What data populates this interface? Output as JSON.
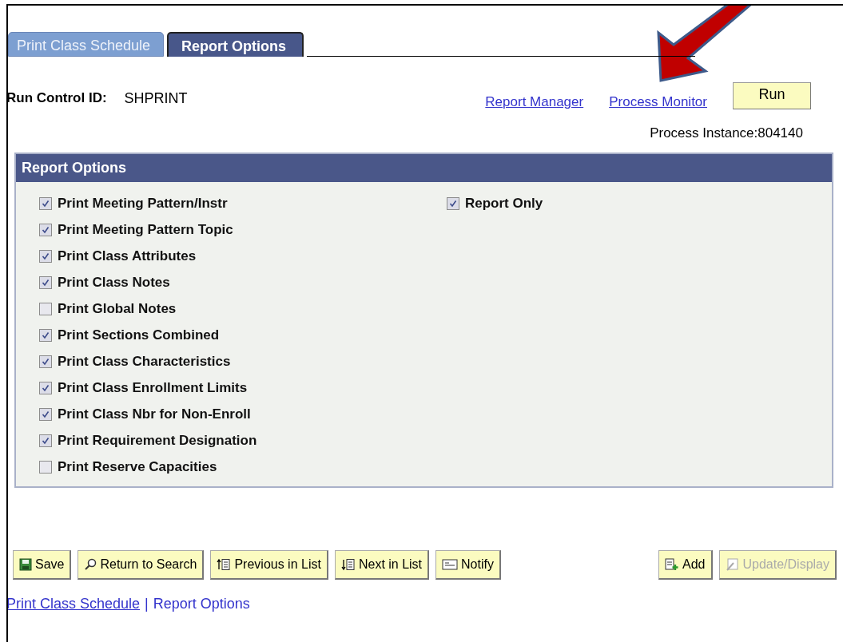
{
  "tabs": [
    {
      "label": "Print Class Schedule",
      "selected": false
    },
    {
      "label": "Report Options",
      "selected": true
    }
  ],
  "run_control": {
    "label": "Run Control ID:",
    "value": "SHPRINT"
  },
  "links": [
    "Report Manager",
    "Process Monitor"
  ],
  "run_button": "Run",
  "process_instance": "Process Instance:804140",
  "report_options": {
    "title": "Report Options",
    "left": [
      {
        "label": "Print Meeting Pattern/Instr",
        "checked": true
      },
      {
        "label": "Print Meeting Pattern Topic",
        "checked": true
      },
      {
        "label": "Print Class Attributes",
        "checked": true
      },
      {
        "label": "Print Class Notes",
        "checked": true
      },
      {
        "label": "Print Global Notes",
        "checked": false
      },
      {
        "label": "Print Sections Combined",
        "checked": true
      },
      {
        "label": "Print Class Characteristics",
        "checked": true
      },
      {
        "label": "Print Class Enrollment Limits",
        "checked": true
      },
      {
        "label": "Print Class Nbr for Non-Enroll",
        "checked": true
      },
      {
        "label": "Print Requirement Designation",
        "checked": true
      },
      {
        "label": "Print Reserve Capacities",
        "checked": false
      }
    ],
    "right": [
      {
        "label": "Report Only",
        "checked": true
      }
    ]
  },
  "toolbar_left": [
    {
      "kind": "save",
      "label": "Save",
      "disabled": false
    },
    {
      "kind": "search",
      "label": "Return to Search",
      "disabled": false
    },
    {
      "kind": "previous",
      "label": "Previous in List",
      "disabled": false
    },
    {
      "kind": "next",
      "label": "Next in List",
      "disabled": false
    },
    {
      "kind": "notify",
      "label": "Notify",
      "disabled": false
    }
  ],
  "toolbar_right": [
    {
      "kind": "add",
      "label": "Add",
      "disabled": false
    },
    {
      "kind": "update",
      "label": "Update/Display",
      "disabled": true
    }
  ],
  "footer_separator": "|",
  "footer_links": [
    {
      "label": "Print Class Schedule",
      "selected": false
    },
    {
      "label": "Report Options",
      "selected": true
    }
  ]
}
